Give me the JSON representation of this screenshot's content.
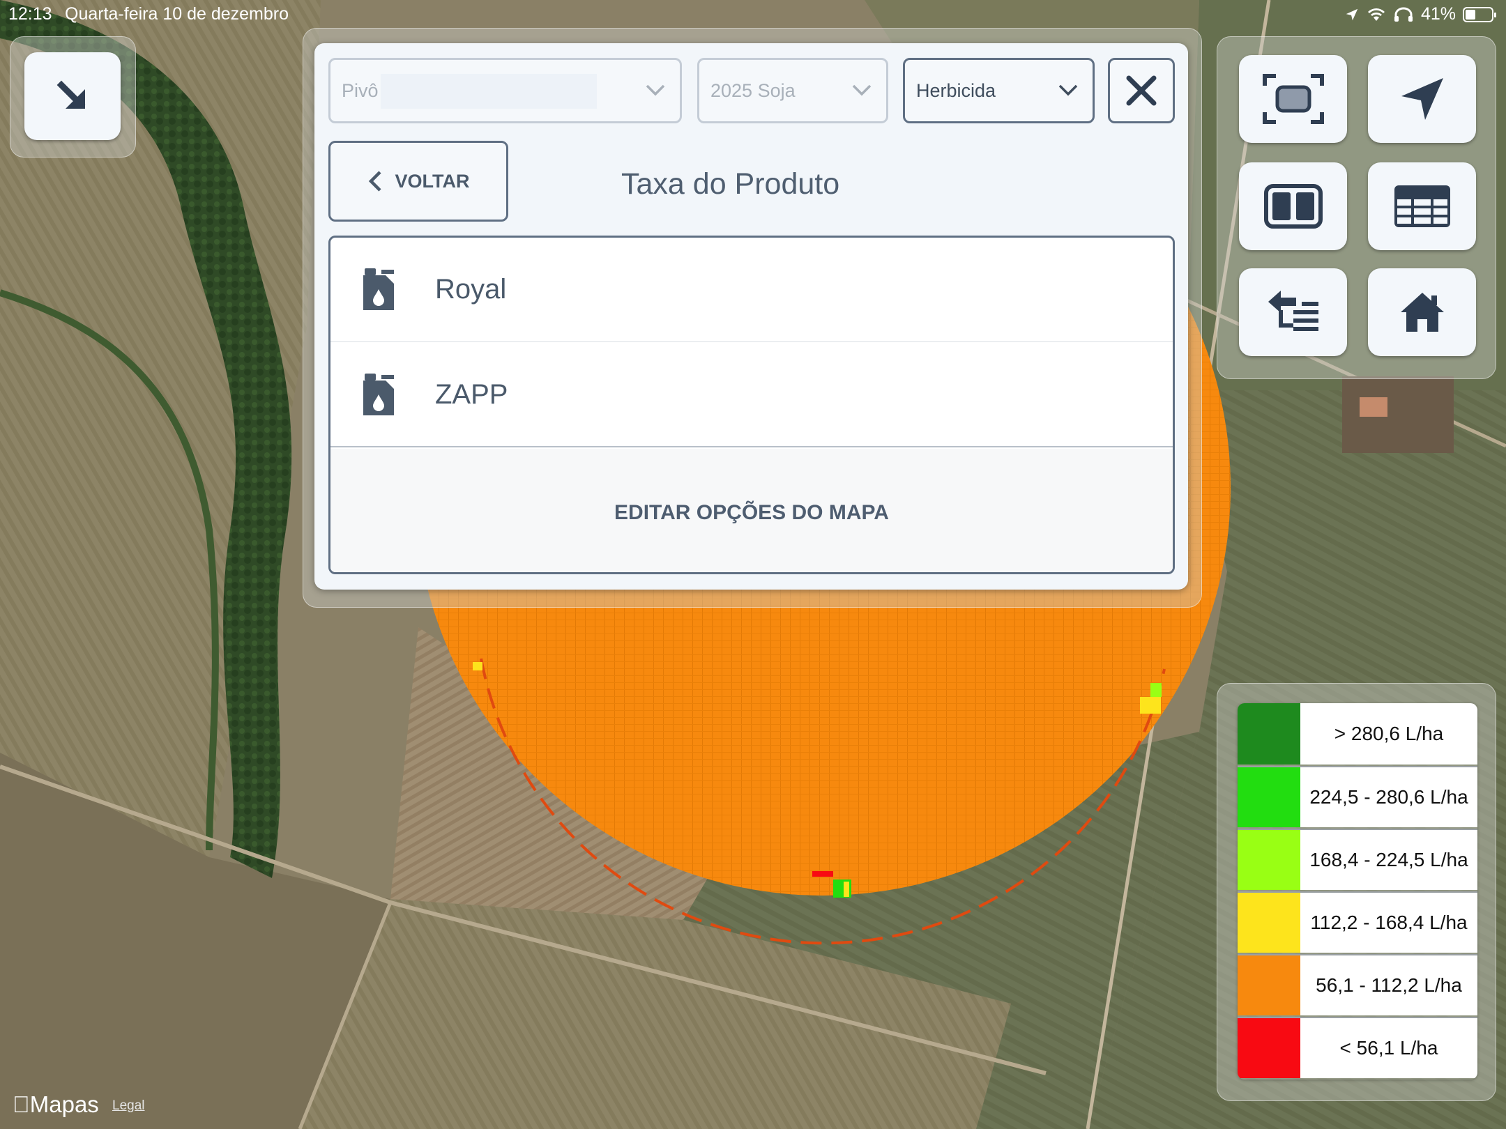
{
  "status_bar": {
    "time": "12:13",
    "date": "Quarta-feira 10 de dezembro",
    "battery": "41%"
  },
  "collapse_button": {
    "icon": "arrow-down-right-icon"
  },
  "panel": {
    "selectors": {
      "pivot": "Pivô",
      "season": "2025 Soja",
      "category": "Herbicida"
    },
    "back_label": "VOLTAR",
    "title": "Taxa do Produto",
    "products": [
      {
        "name": "Royal",
        "icon": "chemical-jug-icon"
      },
      {
        "name": "ZAPP",
        "icon": "chemical-jug-icon"
      }
    ],
    "edit_label": "EDITAR OPÇÕES DO MAPA"
  },
  "tools": [
    {
      "name": "fit-extent",
      "icon": "focus-frame-icon"
    },
    {
      "name": "locate",
      "icon": "location-arrow-icon"
    },
    {
      "name": "split-view",
      "icon": "split-view-icon"
    },
    {
      "name": "table-view",
      "icon": "table-icon"
    },
    {
      "name": "layer-list",
      "icon": "layer-switch-icon"
    },
    {
      "name": "home",
      "icon": "home-icon"
    }
  ],
  "legend": [
    {
      "color": "#1e8a1e",
      "label": "> 280,6 L/ha"
    },
    {
      "color": "#22dd10",
      "label": "224,5 - 280,6 L/ha"
    },
    {
      "color": "#99ff14",
      "label": "168,4 - 224,5 L/ha"
    },
    {
      "color": "#fde41c",
      "label": "112,2 - 168,4 L/ha"
    },
    {
      "color": "#f7890e",
      "label": "56,1 - 112,2 L/ha"
    },
    {
      "color": "#f80a12",
      "label": "< 56,1 L/ha"
    }
  ],
  "map_attribution": {
    "provider": "Mapas",
    "legal": "Legal"
  },
  "colors": {
    "panel_border": "#5f6f83",
    "panel_text": "#4f5e70",
    "coverage_fill": "#f7890e"
  }
}
